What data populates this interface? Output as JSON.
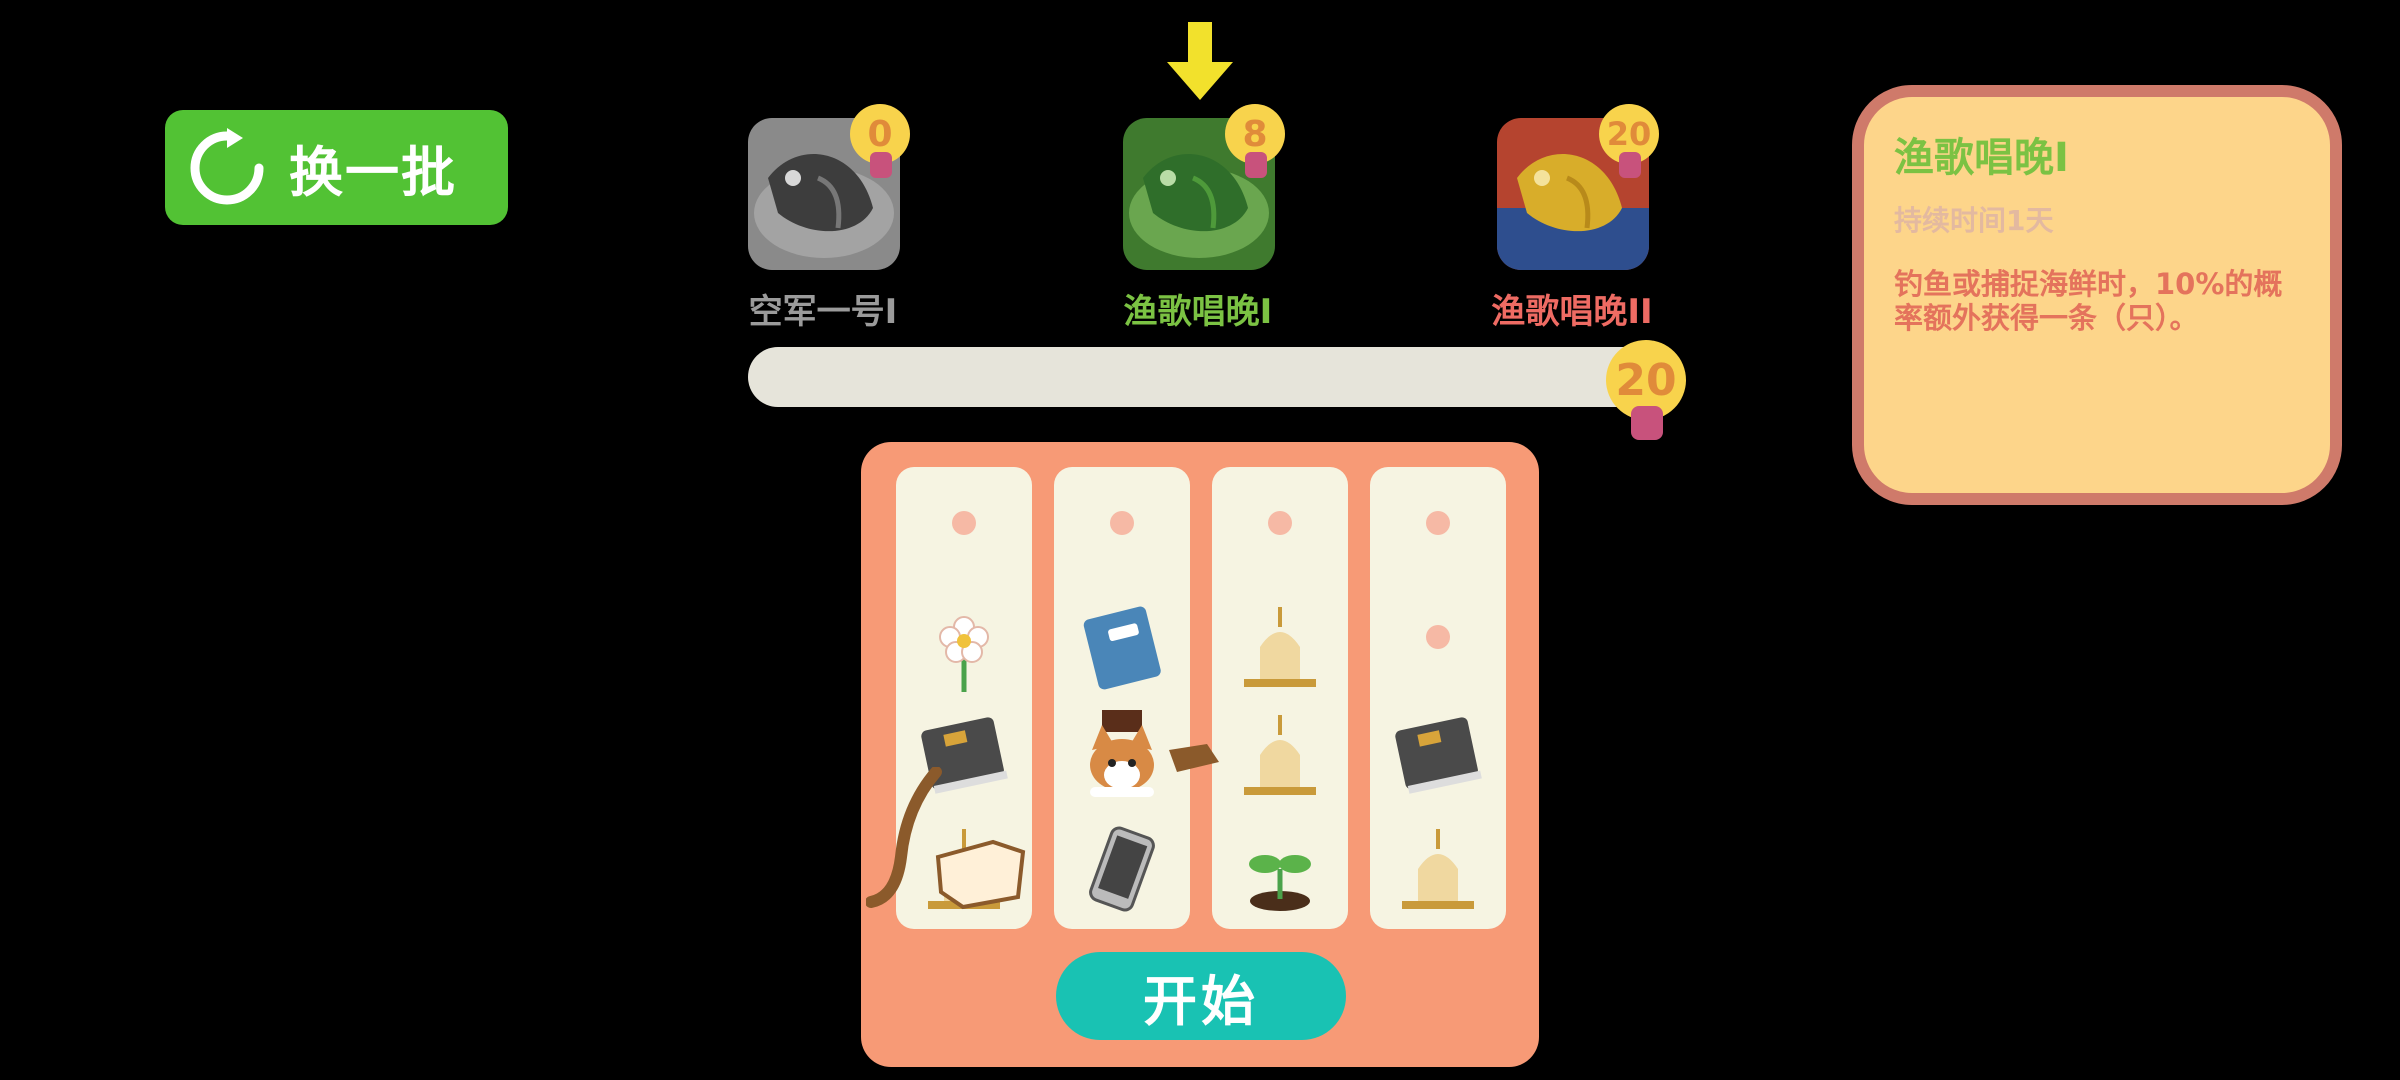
{
  "refresh_button": {
    "label": "换一批",
    "icon": "refresh-icon"
  },
  "tiers": [
    {
      "name": "空军一号I",
      "count": "0",
      "color": "#9b9b9b"
    },
    {
      "name": "渔歌唱晚I",
      "count": "8",
      "color": "#7bc243"
    },
    {
      "name": "渔歌唱晚II",
      "count": "20",
      "color": "#ee6b63"
    }
  ],
  "progress": {
    "value": "20",
    "fraction": 1.0
  },
  "info_card": {
    "title": "渔歌唱晚I",
    "duration": "持续时间1天",
    "description": "钓鱼或捕捉海鲜时，10%的概率额外获得一条（只）。"
  },
  "reels": [
    [
      "dot",
      "flower-icon",
      "book-icon",
      "bell-icon"
    ],
    [
      "dot",
      "notebook-icon",
      "corgi-icon",
      "phone-icon"
    ],
    [
      "dot",
      "bell-icon",
      "bell-icon",
      "sprout-icon"
    ],
    [
      "dot",
      "dot",
      "book-icon",
      "bell-icon"
    ]
  ],
  "start_button": {
    "label": "开始"
  },
  "colors": {
    "accent_green": "#52c234",
    "panel": "#f79a76",
    "start": "#19c2b3"
  }
}
